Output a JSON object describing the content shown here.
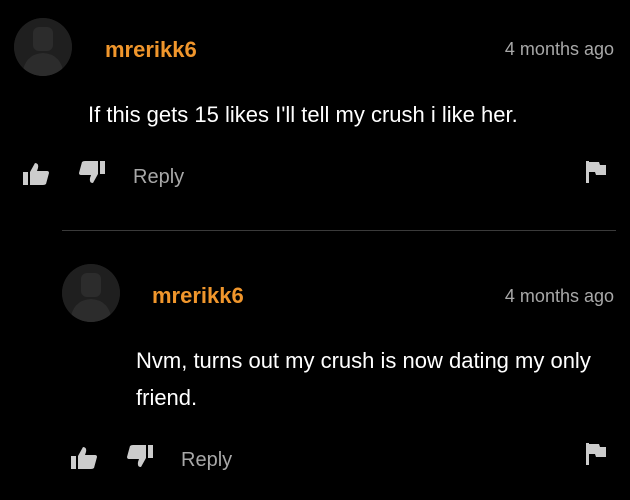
{
  "comments": [
    {
      "username": "mrerikk6",
      "timestamp": "4 months ago",
      "text": "If this gets 15 likes I'll tell my crush i like her.",
      "reply_label": "Reply"
    },
    {
      "username": "mrerikk6",
      "timestamp": "4 months ago",
      "text": "Nvm, turns out my crush is now dating my only friend.",
      "reply_label": "Reply"
    }
  ],
  "colors": {
    "background": "#000000",
    "username": "#f0962c",
    "muted_text": "#a8a8a8",
    "icon": "#cccccc"
  },
  "icons": {
    "avatar": "default-user-avatar",
    "like": "thumbs-up-icon",
    "dislike": "thumbs-down-icon",
    "flag": "flag-icon"
  }
}
